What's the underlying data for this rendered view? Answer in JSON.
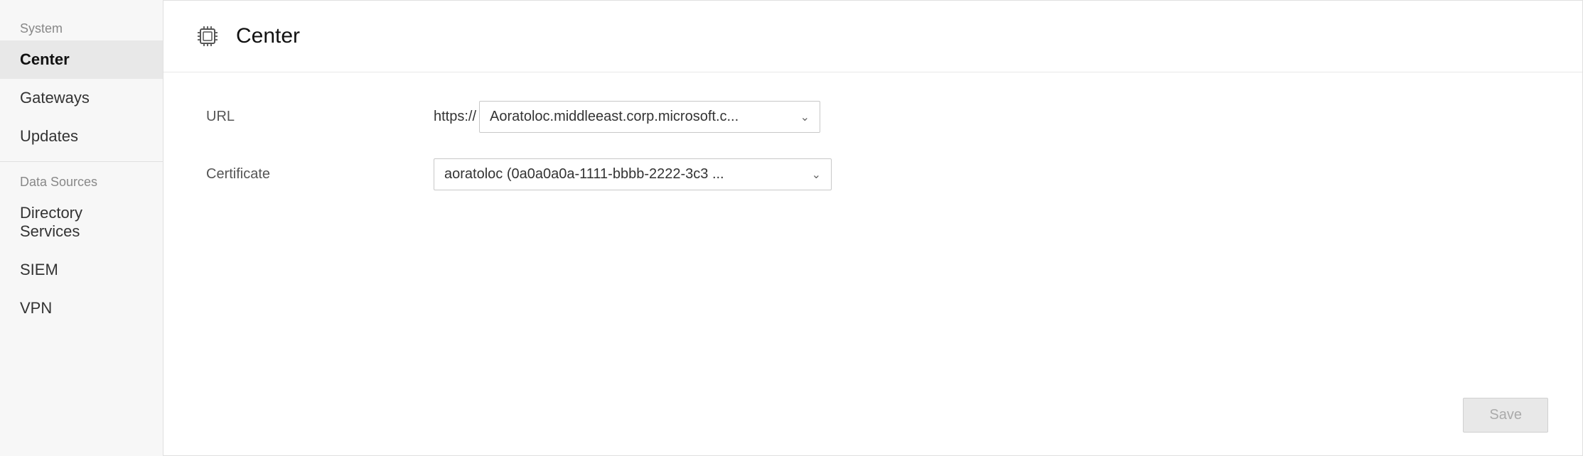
{
  "sidebar": {
    "system_section_label": "System",
    "items": [
      {
        "id": "center",
        "label": "Center",
        "active": true
      },
      {
        "id": "gateways",
        "label": "Gateways",
        "active": false
      },
      {
        "id": "updates",
        "label": "Updates",
        "active": false
      }
    ],
    "datasources_section_label": "Data Sources",
    "datasource_items": [
      {
        "id": "directory-services",
        "label": "Directory Services",
        "active": false
      },
      {
        "id": "siem",
        "label": "SIEM",
        "active": false
      },
      {
        "id": "vpn",
        "label": "VPN",
        "active": false
      }
    ]
  },
  "page": {
    "title": "Center",
    "icon": "chip-icon"
  },
  "form": {
    "url_label": "URL",
    "url_prefix": "https://",
    "url_value": "Aoratoloc.middleeast.corp.microsoft.c...",
    "cert_label": "Certificate",
    "cert_value": "aoratoloc (0a0a0a0a-1111-bbbb-2222-3c3 ..."
  },
  "buttons": {
    "save_label": "Save"
  }
}
